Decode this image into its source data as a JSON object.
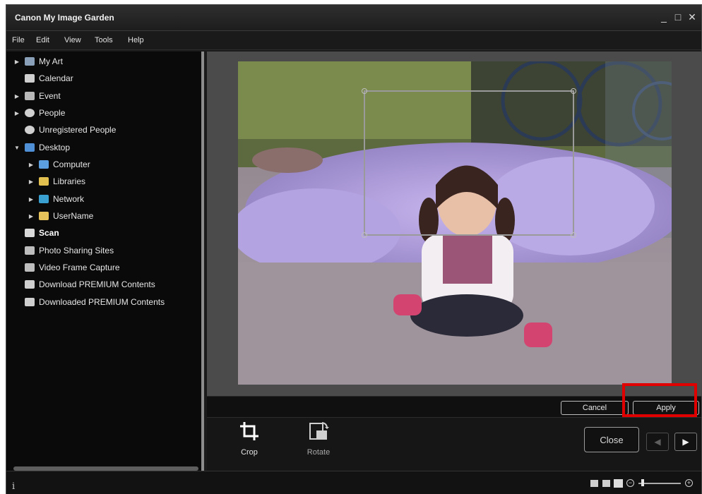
{
  "window": {
    "title": "Canon My Image Garden"
  },
  "menu": {
    "items": [
      "File",
      "Edit",
      "View",
      "Tools",
      "Help"
    ]
  },
  "sidebar": {
    "items": [
      {
        "label": "My Art",
        "icon": "my-art-icon",
        "expandable": true
      },
      {
        "label": "Calendar",
        "icon": "calendar-icon",
        "expandable": false
      },
      {
        "label": "Event",
        "icon": "event-icon",
        "expandable": true
      },
      {
        "label": "People",
        "icon": "people-icon",
        "expandable": true
      },
      {
        "label": "Unregistered People",
        "icon": "unregistered-people-icon",
        "expandable": false
      },
      {
        "label": "Desktop",
        "icon": "desktop-icon",
        "expandable": true,
        "expanded": true
      },
      {
        "label": "Computer",
        "icon": "computer-icon",
        "expandable": true,
        "indent": 1
      },
      {
        "label": "Libraries",
        "icon": "libraries-icon",
        "expandable": true,
        "indent": 1
      },
      {
        "label": "Network",
        "icon": "network-icon",
        "expandable": true,
        "indent": 1
      },
      {
        "label": "UserName",
        "icon": "user-folder-icon",
        "expandable": true,
        "indent": 1
      },
      {
        "label": "Scan",
        "icon": "scan-icon",
        "expandable": false,
        "selected": true
      },
      {
        "label": "Photo Sharing Sites",
        "icon": "photo-sharing-icon",
        "expandable": false
      },
      {
        "label": "Video Frame Capture",
        "icon": "video-frame-icon",
        "expandable": false
      },
      {
        "label": "Download PREMIUM Contents",
        "icon": "download-premium-icon",
        "expandable": false
      },
      {
        "label": "Downloaded PREMIUM Contents",
        "icon": "downloaded-premium-icon",
        "expandable": false
      }
    ]
  },
  "actions": {
    "cancel": "Cancel",
    "apply": "Apply"
  },
  "tools": {
    "crop": "Crop",
    "rotate": "Rotate"
  },
  "nav": {
    "close": "Close"
  },
  "status": {
    "info": "i"
  },
  "colors": {
    "highlight": "#e00000",
    "panel": "#4b4b4b",
    "sidebar": "#0a0a0a"
  }
}
